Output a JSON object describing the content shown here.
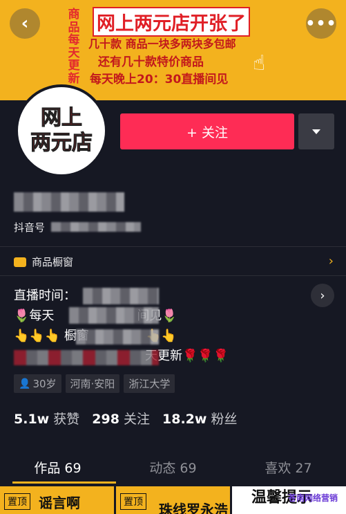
{
  "banner": {
    "vertical_text": "商品每天更新",
    "line1": "网上两元店开张了",
    "line2": "几十款 商品一块多两块多包邮",
    "line3": "还有几十款特价商品",
    "line4": "每天晚上20：30直播间见",
    "hand_icon": "☝"
  },
  "nav": {
    "back_icon": "‹",
    "more_icon": "•••"
  },
  "avatar": {
    "line1": "网上",
    "line2": "两元店"
  },
  "actions": {
    "follow_label": "+ 关注"
  },
  "profile": {
    "douyin_id_label": "抖音号"
  },
  "shop": {
    "label": "商品橱窗",
    "chevron": "›"
  },
  "bio": {
    "line1": "直播时间：",
    "line2_start": "🌷每天",
    "line2_end": "间见🌷",
    "line3_start": "👆👆👆 橱窗",
    "line3_end": "👆👆",
    "line4_end": "天更新🌹🌹🌹",
    "arrow": "›"
  },
  "tags": [
    {
      "label": "30岁",
      "icon": "person-icon"
    },
    {
      "label": "河南·安阳"
    },
    {
      "label": "浙江大学"
    }
  ],
  "stats": {
    "likes_value": "5.1w",
    "likes_label": "获赞",
    "following_value": "298",
    "following_label": "关注",
    "followers_value": "18.2w",
    "followers_label": "粉丝"
  },
  "tabs": [
    {
      "label": "作品 69"
    },
    {
      "label": "动态 69"
    },
    {
      "label": "喜欢 27"
    }
  ],
  "grid": [
    {
      "pin": "置顶",
      "text": "谣言啊"
    },
    {
      "pin": "置顶",
      "text": "珠线罗永浩"
    },
    {
      "text": "温馨提示"
    }
  ],
  "watermark": "苍南网络营销"
}
